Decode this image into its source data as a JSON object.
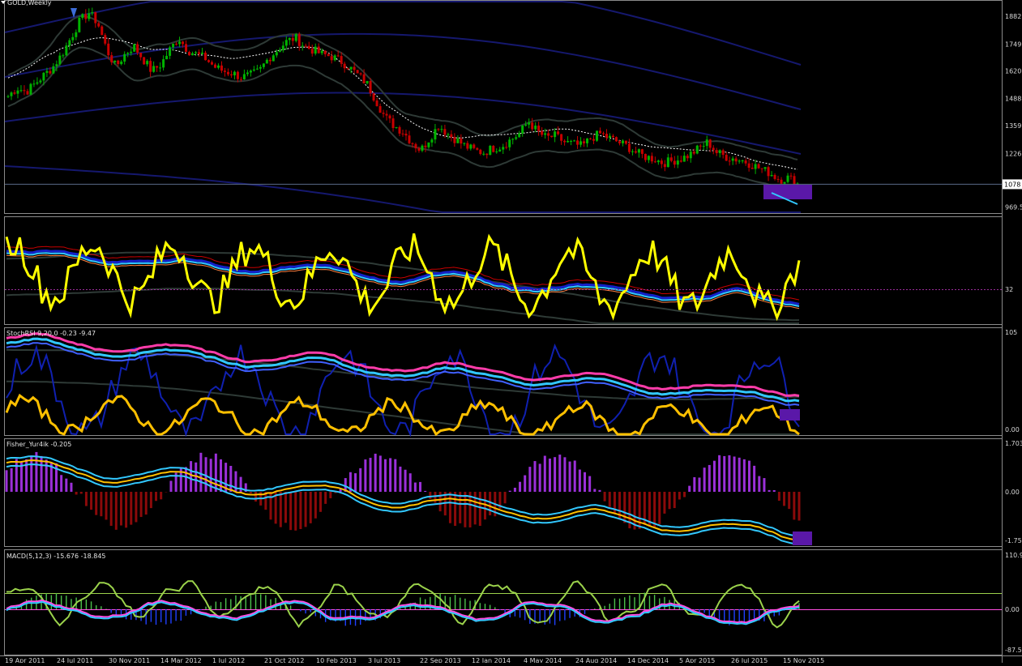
{
  "window": {
    "symbol_title": "GOLD,Weekly"
  },
  "colors": {
    "background": "#000000",
    "bull_candle": "#00b400",
    "bear_candle": "#c80000",
    "bollinger": "#2e3a36",
    "envelope_band": "#15186e",
    "price_line": "#5a6a88",
    "yellow_line": "#ffff00",
    "orange_line": "#ffc000",
    "cyan_line": "#32c8ff",
    "magenta_line": "#ff3caa",
    "blue_line": "#1420c8",
    "histogram_pos": "#9b30d9",
    "histogram_neg": "#8b0a0a",
    "macd_main": "#ff4de1",
    "macd_signal": "#9bd24b",
    "marker_box": "#5a18a8"
  },
  "icons": {
    "arrow_marker": "down-arrow-icon",
    "title_marker": "triangle-icon"
  },
  "chart_data": [
    {
      "type": "candlestick",
      "title": "GOLD,Weekly",
      "price_scale_labels": [
        "1882",
        "1749",
        "1620",
        "1488",
        "1359",
        "1226",
        "1078",
        "969.5"
      ],
      "current_price_label": "1078",
      "ylim": [
        940,
        1960
      ],
      "x_labels": [
        "19 Apr 2011",
        "24 Jul 2011",
        "30 Nov 2011",
        "14 Mar 2012",
        "1 Jul 2012",
        "21 Oct 2012",
        "10 Feb 2013",
        "3 Jul 2013",
        "22 Sep 2013",
        "12 Jan 2014",
        "4 May 2014",
        "24 Aug 2014",
        "14 Dec 2014",
        "5 Apr 2015",
        "26 Jul 2015",
        "15 Nov 2015"
      ],
      "close_approx": [
        1500,
        1540,
        1520,
        1560,
        1600,
        1640,
        1700,
        1780,
        1860,
        1900,
        1850,
        1720,
        1640,
        1700,
        1740,
        1680,
        1620,
        1650,
        1720,
        1780,
        1720,
        1700,
        1680,
        1640,
        1620,
        1610,
        1590,
        1600,
        1620,
        1680,
        1720,
        1760,
        1780,
        1740,
        1720,
        1700,
        1690,
        1670,
        1640,
        1600,
        1560,
        1480,
        1400,
        1360,
        1330,
        1280,
        1240,
        1300,
        1360,
        1320,
        1290,
        1260,
        1240,
        1230,
        1250,
        1260,
        1290,
        1320,
        1380,
        1330,
        1300,
        1310,
        1280,
        1270,
        1260,
        1300,
        1320,
        1300,
        1280,
        1260,
        1230,
        1210,
        1200,
        1180,
        1190,
        1200,
        1220,
        1250,
        1280,
        1230,
        1210,
        1200,
        1190,
        1170,
        1150,
        1130,
        1100,
        1110,
        1080
      ]
    },
    {
      "type": "line",
      "title": "",
      "scale_labels": [
        "32"
      ],
      "series": []
    },
    {
      "type": "line",
      "title": "StochRSI 9,20,0 -0.23 -9.47",
      "scale_labels": [
        "105",
        "0.00"
      ],
      "series": []
    },
    {
      "type": "bar",
      "title": "Fisher_Yur4ik -0.205",
      "scale_labels": [
        "1.703",
        "0.00",
        "-1.75"
      ],
      "series": []
    },
    {
      "type": "bar",
      "title": "MACD(5,12,3) -15.676 -18.845",
      "scale_labels": [
        "110.9",
        "0.00",
        "-87.5"
      ],
      "series": []
    }
  ]
}
